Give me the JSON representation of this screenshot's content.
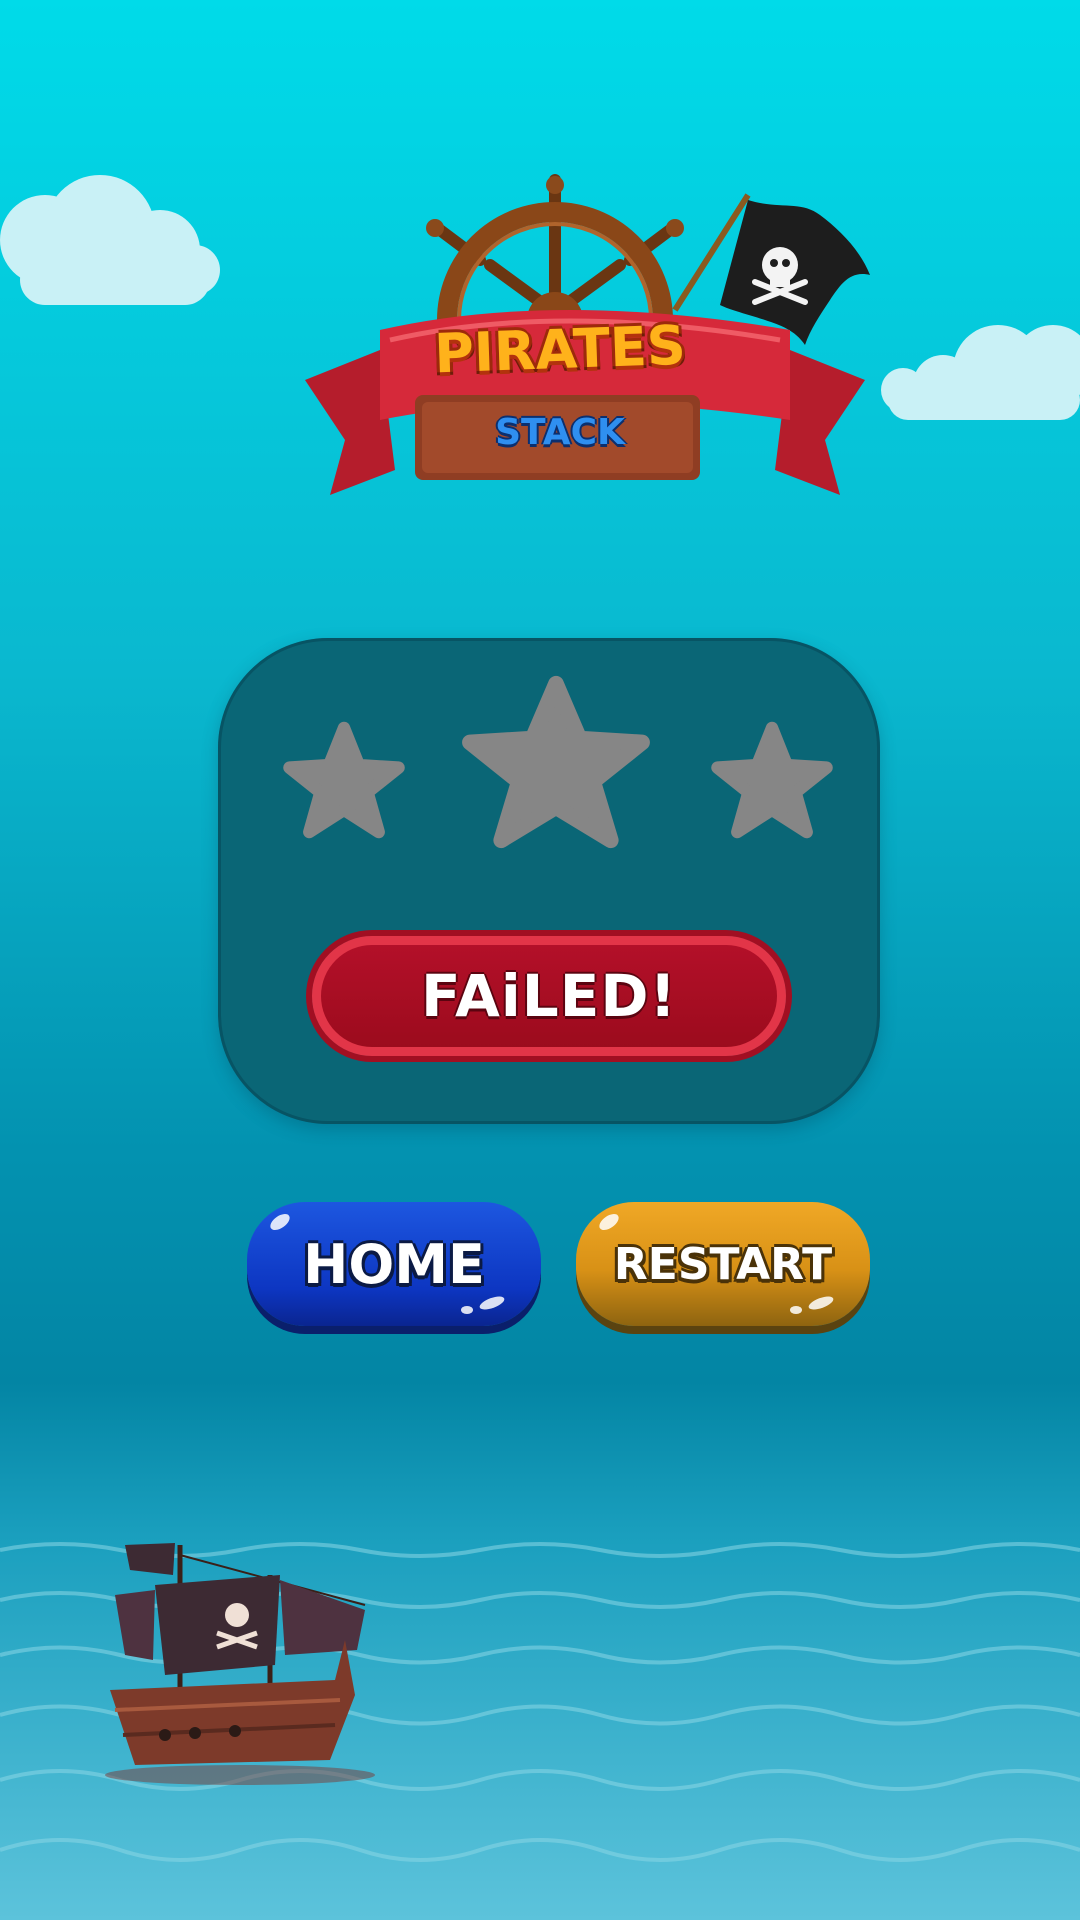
{
  "logo": {
    "title": "PIRATES",
    "subtitle": "STACK"
  },
  "result": {
    "stars_earned": 0,
    "stars_total": 3,
    "status_label": "FAiLED!"
  },
  "buttons": {
    "home_label": "HOME",
    "restart_label": "RESTART"
  },
  "colors": {
    "panel": "#0a6676",
    "failed_banner": "#b5102a",
    "home_button": "#1d57e0",
    "restart_button": "#f0a826",
    "empty_star": "#868686"
  },
  "icons": {
    "logo": "ship-wheel-banner",
    "flag": "jolly-roger-flag",
    "ship": "pirate-ship"
  }
}
